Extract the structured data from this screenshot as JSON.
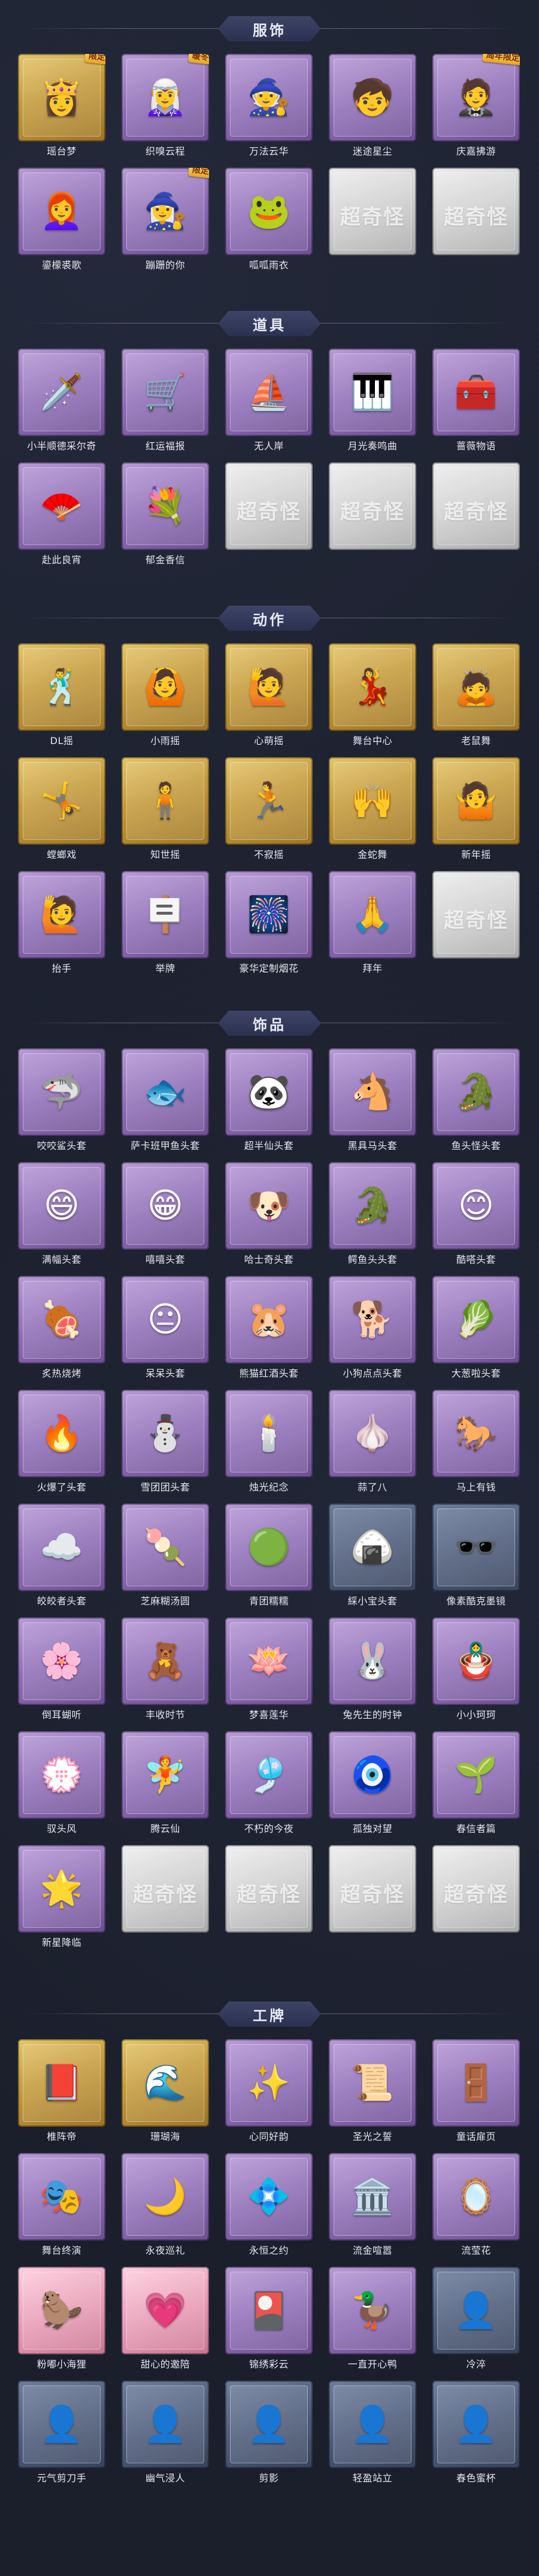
{
  "sections": [
    {
      "title": "服饰",
      "items": [
        {
          "label": "瑶台梦",
          "frame": "gold",
          "icon": "character-costume-icon",
          "glyph": "👸",
          "badge": "限定"
        },
        {
          "label": "织嗅云程",
          "frame": "purple",
          "icon": "character-costume-icon",
          "glyph": "🧝‍♀️",
          "badge": "暖冬"
        },
        {
          "label": "万法云华",
          "frame": "purple",
          "icon": "character-costume-icon",
          "glyph": "🧙",
          "badge": ""
        },
        {
          "label": "迷途星尘",
          "frame": "purple",
          "icon": "character-costume-icon",
          "glyph": "🧒",
          "badge": ""
        },
        {
          "label": "庆嘉拂游",
          "frame": "purple",
          "icon": "character-costume-icon",
          "glyph": "🤵",
          "badge": "周年限定"
        },
        {
          "label": "鎏檬裘歌",
          "frame": "purple",
          "icon": "character-costume-icon",
          "glyph": "👩‍🦰",
          "badge": ""
        },
        {
          "label": "蹦跚的你",
          "frame": "purple",
          "icon": "character-costume-icon",
          "glyph": "🧙‍♀️",
          "badge": "限定"
        },
        {
          "label": "呱呱雨衣",
          "frame": "purple",
          "icon": "character-costume-icon",
          "glyph": "🐸",
          "badge": ""
        },
        {
          "label": "",
          "frame": "grey",
          "icon": "placeholder-card-icon",
          "glyph": "",
          "badge": "",
          "wm": "超奇怪"
        },
        {
          "label": "",
          "frame": "grey",
          "icon": "placeholder-card-icon",
          "glyph": "",
          "badge": "",
          "wm": "超奇怪"
        }
      ]
    },
    {
      "title": "道具",
      "items": [
        {
          "label": "小半顺德采尔奇",
          "frame": "purple",
          "icon": "sword-prop-icon",
          "glyph": "🗡️",
          "badge": ""
        },
        {
          "label": "红运福报",
          "frame": "purple",
          "icon": "lucky-cart-icon",
          "glyph": "🛒",
          "badge": ""
        },
        {
          "label": "无人岸",
          "frame": "purple",
          "icon": "boat-prop-icon",
          "glyph": "⛵",
          "badge": ""
        },
        {
          "label": "月光奏鸣曲",
          "frame": "purple",
          "icon": "piano-prop-icon",
          "glyph": "🎹",
          "badge": ""
        },
        {
          "label": "蔷薇物语",
          "frame": "purple",
          "icon": "medkit-prop-icon",
          "glyph": "🧰",
          "badge": ""
        },
        {
          "label": "赴此良宵",
          "frame": "purple",
          "icon": "fan-prop-icon",
          "glyph": "🪭",
          "badge": ""
        },
        {
          "label": "郁金香信",
          "frame": "purple",
          "icon": "wreath-prop-icon",
          "glyph": "💐",
          "badge": ""
        },
        {
          "label": "",
          "frame": "grey",
          "icon": "placeholder-card-icon",
          "glyph": "",
          "badge": "",
          "wm": "超奇怪"
        },
        {
          "label": "",
          "frame": "grey",
          "icon": "placeholder-card-icon",
          "glyph": "",
          "badge": "",
          "wm": "超奇怪"
        },
        {
          "label": "",
          "frame": "grey",
          "icon": "placeholder-card-icon",
          "glyph": "",
          "badge": "",
          "wm": "超奇怪"
        }
      ]
    },
    {
      "title": "动作",
      "items": [
        {
          "label": "DL摇",
          "frame": "gold",
          "icon": "emote-pose-icon",
          "glyph": "🕺",
          "badge": ""
        },
        {
          "label": "小雨摇",
          "frame": "gold",
          "icon": "emote-pose-icon",
          "glyph": "🙆",
          "badge": ""
        },
        {
          "label": "心萌摇",
          "frame": "gold",
          "icon": "emote-pose-icon",
          "glyph": "🙋",
          "badge": ""
        },
        {
          "label": "舞台中心",
          "frame": "gold",
          "icon": "emote-pose-icon",
          "glyph": "💃",
          "badge": ""
        },
        {
          "label": "老鼠舞",
          "frame": "gold",
          "icon": "emote-pose-icon",
          "glyph": "🙇",
          "badge": ""
        },
        {
          "label": "螳螂戏",
          "frame": "gold",
          "icon": "emote-pose-icon",
          "glyph": "🤸",
          "badge": ""
        },
        {
          "label": "知世摇",
          "frame": "gold",
          "icon": "emote-pose-icon",
          "glyph": "🧍",
          "badge": ""
        },
        {
          "label": "不寂摇",
          "frame": "gold",
          "icon": "emote-pose-icon",
          "glyph": "🏃",
          "badge": ""
        },
        {
          "label": "金蛇舞",
          "frame": "gold",
          "icon": "emote-pose-icon",
          "glyph": "🙌",
          "badge": ""
        },
        {
          "label": "新年摇",
          "frame": "gold",
          "icon": "emote-pose-icon",
          "glyph": "🤷",
          "badge": ""
        },
        {
          "label": "抬手",
          "frame": "purple",
          "icon": "emote-pose-icon",
          "glyph": "🙋",
          "badge": ""
        },
        {
          "label": "举牌",
          "frame": "purple",
          "icon": "emote-sign-icon",
          "glyph": "🪧",
          "badge": ""
        },
        {
          "label": "豪华定制烟花",
          "frame": "purple",
          "icon": "firework-icon",
          "glyph": "🎆",
          "badge": ""
        },
        {
          "label": "拜年",
          "frame": "purple",
          "icon": "emote-pose-icon",
          "glyph": "🙏",
          "badge": ""
        },
        {
          "label": "",
          "frame": "grey",
          "icon": "placeholder-card-icon",
          "glyph": "",
          "badge": "",
          "wm": "超奇怪"
        }
      ]
    },
    {
      "title": "饰品",
      "items": [
        {
          "label": "咬咬鲨头套",
          "frame": "purple",
          "icon": "shark-head-icon",
          "glyph": "🦈",
          "badge": ""
        },
        {
          "label": "萨卡班甲鱼头套",
          "frame": "purple",
          "icon": "fish-head-icon",
          "glyph": "🐟",
          "badge": ""
        },
        {
          "label": "超半仙头套",
          "frame": "purple",
          "icon": "panda-head-icon",
          "glyph": "🐼",
          "badge": ""
        },
        {
          "label": "黑具马头套",
          "frame": "purple",
          "icon": "horse-head-icon",
          "glyph": "🐴",
          "badge": ""
        },
        {
          "label": "鱼头怪头套",
          "frame": "purple",
          "icon": "fish-monster-head-icon",
          "glyph": "🐊",
          "badge": ""
        },
        {
          "label": "满幅头套",
          "frame": "purple",
          "icon": "smile-head-icon",
          "glyph": "😄",
          "badge": ""
        },
        {
          "label": "嘻嘻头套",
          "frame": "purple",
          "icon": "grin-head-icon",
          "glyph": "😁",
          "badge": ""
        },
        {
          "label": "哈士奇头套",
          "frame": "purple",
          "icon": "husky-head-icon",
          "glyph": "🐶",
          "badge": ""
        },
        {
          "label": "鳄鱼头头套",
          "frame": "purple",
          "icon": "croc-head-icon",
          "glyph": "🐊",
          "badge": ""
        },
        {
          "label": "酷嗒头套",
          "frame": "purple",
          "icon": "emoji-head-icon",
          "glyph": "😊",
          "badge": ""
        },
        {
          "label": "炙热烧烤",
          "frame": "purple",
          "icon": "bbq-head-icon",
          "glyph": "🍖",
          "badge": ""
        },
        {
          "label": "呆呆头套",
          "frame": "purple",
          "icon": "emoji-head-icon",
          "glyph": "😐",
          "badge": ""
        },
        {
          "label": "熊猫红酒头套",
          "frame": "purple",
          "icon": "pikachu-head-icon",
          "glyph": "🐹",
          "badge": ""
        },
        {
          "label": "小狗点点头套",
          "frame": "purple",
          "icon": "puppy-head-icon",
          "glyph": "🐕",
          "badge": ""
        },
        {
          "label": "大葱啦头套",
          "frame": "purple",
          "icon": "leek-head-icon",
          "glyph": "🥬",
          "badge": ""
        },
        {
          "label": "火爆了头套",
          "frame": "purple",
          "icon": "fire-head-icon",
          "glyph": "🔥",
          "badge": ""
        },
        {
          "label": "雪团团头套",
          "frame": "purple",
          "icon": "snowman-head-icon",
          "glyph": "⛄",
          "badge": ""
        },
        {
          "label": "烛光纪念",
          "frame": "purple",
          "icon": "candle-head-icon",
          "glyph": "🕯️",
          "badge": ""
        },
        {
          "label": "蒜了八",
          "frame": "purple",
          "icon": "garlic-head-icon",
          "glyph": "🧄",
          "badge": ""
        },
        {
          "label": "马上有钱",
          "frame": "purple",
          "icon": "horse-money-icon",
          "glyph": "🐎",
          "badge": ""
        },
        {
          "label": "皎皎者头套",
          "frame": "purple",
          "icon": "cloud-head-icon",
          "glyph": "☁️",
          "badge": ""
        },
        {
          "label": "芝麻糊汤圆",
          "frame": "purple",
          "icon": "dumpling-head-icon",
          "glyph": "🍡",
          "badge": ""
        },
        {
          "label": "青团糯糯",
          "frame": "purple",
          "icon": "green-dumpling-icon",
          "glyph": "🟢",
          "badge": ""
        },
        {
          "label": "綵小宝头套",
          "frame": "blue",
          "icon": "rice-ball-icon",
          "glyph": "🍙",
          "badge": ""
        },
        {
          "label": "像素酷克墨镜",
          "frame": "blue",
          "icon": "pixel-glasses-icon",
          "glyph": "🕶️",
          "badge": ""
        },
        {
          "label": "倒耳蝴听",
          "frame": "purple",
          "icon": "ear-flower-icon",
          "glyph": "🌸",
          "badge": ""
        },
        {
          "label": "丰收时节",
          "frame": "purple",
          "icon": "harvest-doll-icon",
          "glyph": "🧸",
          "badge": ""
        },
        {
          "label": "梦喜莲华",
          "frame": "purple",
          "icon": "lotus-doll-icon",
          "glyph": "🪷",
          "badge": ""
        },
        {
          "label": "兔先生的时钟",
          "frame": "purple",
          "icon": "rabbit-clock-icon",
          "glyph": "🐰",
          "badge": ""
        },
        {
          "label": "小小珂珂",
          "frame": "purple",
          "icon": "doll-icon",
          "glyph": "🪆",
          "badge": ""
        },
        {
          "label": "驭头风",
          "frame": "purple",
          "icon": "flower-girl-icon",
          "glyph": "💮",
          "badge": ""
        },
        {
          "label": "腾云仙",
          "frame": "purple",
          "icon": "cloud-pendant-icon",
          "glyph": "🧚",
          "badge": ""
        },
        {
          "label": "不朽的今夜",
          "frame": "purple",
          "icon": "pendant-icon",
          "glyph": "🎐",
          "badge": ""
        },
        {
          "label": "孤独对望",
          "frame": "purple",
          "icon": "pendant-icon",
          "glyph": "🧿",
          "badge": ""
        },
        {
          "label": "春信者篇",
          "frame": "purple",
          "icon": "sprout-pendant-icon",
          "glyph": "🌱",
          "badge": ""
        },
        {
          "label": "新星降临",
          "frame": "purple",
          "icon": "star-pendant-icon",
          "glyph": "🌟",
          "badge": ""
        },
        {
          "label": "",
          "frame": "grey",
          "icon": "placeholder-card-icon",
          "glyph": "",
          "badge": "",
          "wm": "超奇怪"
        },
        {
          "label": "",
          "frame": "grey",
          "icon": "placeholder-card-icon",
          "glyph": "",
          "badge": "",
          "wm": "超奇怪"
        },
        {
          "label": "",
          "frame": "grey",
          "icon": "placeholder-card-icon",
          "glyph": "",
          "badge": "",
          "wm": "超奇怪"
        },
        {
          "label": "",
          "frame": "grey",
          "icon": "placeholder-card-icon",
          "glyph": "",
          "badge": "",
          "wm": "超奇怪"
        }
      ]
    },
    {
      "title": "工牌",
      "items": [
        {
          "label": "椎阵帝",
          "frame": "gold",
          "icon": "badge-card-icon",
          "glyph": "📕",
          "badge": ""
        },
        {
          "label": "珊瑚海",
          "frame": "gold",
          "icon": "badge-card-icon",
          "glyph": "🌊",
          "badge": ""
        },
        {
          "label": "心同好韵",
          "frame": "purple",
          "icon": "badge-card-icon",
          "glyph": "✨",
          "badge": ""
        },
        {
          "label": "圣光之誓",
          "frame": "purple",
          "icon": "badge-card-icon",
          "glyph": "📜",
          "badge": ""
        },
        {
          "label": "童话扉页",
          "frame": "purple",
          "icon": "badge-card-icon",
          "glyph": "🚪",
          "badge": ""
        },
        {
          "label": "舞台终演",
          "frame": "purple",
          "icon": "badge-card-icon",
          "glyph": "🎭",
          "badge": ""
        },
        {
          "label": "永夜巡礼",
          "frame": "purple",
          "icon": "badge-card-icon",
          "glyph": "🌙",
          "badge": ""
        },
        {
          "label": "永恒之约",
          "frame": "purple",
          "icon": "badge-card-icon",
          "glyph": "💠",
          "badge": ""
        },
        {
          "label": "流金喧嚣",
          "frame": "purple",
          "icon": "badge-card-icon",
          "glyph": "🏛️",
          "badge": ""
        },
        {
          "label": "流莹花",
          "frame": "purple",
          "icon": "badge-card-icon",
          "glyph": "🪞",
          "badge": ""
        },
        {
          "label": "粉嘟小海狸",
          "frame": "pink",
          "icon": "badge-card-icon",
          "glyph": "🦫",
          "badge": ""
        },
        {
          "label": "甜心的邀陪",
          "frame": "pink",
          "icon": "badge-card-icon",
          "glyph": "💗",
          "badge": ""
        },
        {
          "label": "锦绣彩云",
          "frame": "purple",
          "icon": "badge-card-icon",
          "glyph": "🎴",
          "badge": ""
        },
        {
          "label": "一直开心鸭",
          "frame": "purple",
          "icon": "badge-card-icon",
          "glyph": "🦆",
          "badge": ""
        },
        {
          "label": "冷淬",
          "frame": "blue",
          "icon": "silhouette-badge-icon",
          "glyph": "👤",
          "badge": ""
        },
        {
          "label": "元气剪刀手",
          "frame": "blue",
          "icon": "silhouette-badge-icon",
          "glyph": "👤",
          "badge": ""
        },
        {
          "label": "幽气浸人",
          "frame": "blue",
          "icon": "silhouette-badge-icon",
          "glyph": "👤",
          "badge": ""
        },
        {
          "label": "剪影",
          "frame": "blue",
          "icon": "silhouette-badge-icon",
          "glyph": "👤",
          "badge": ""
        },
        {
          "label": "轻盈站立",
          "frame": "blue",
          "icon": "silhouette-badge-icon",
          "glyph": "👤",
          "badge": ""
        },
        {
          "label": "春色蜜杯",
          "frame": "blue",
          "icon": "silhouette-badge-icon",
          "glyph": "👤",
          "badge": ""
        }
      ]
    }
  ]
}
